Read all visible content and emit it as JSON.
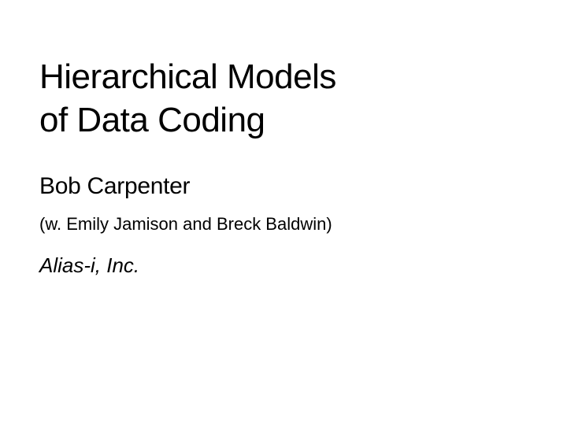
{
  "title_line1": "Hierarchical Models",
  "title_line2": "of Data Coding",
  "author": "Bob Carpenter",
  "coauthors": "(w. Emily Jamison and Breck Baldwin)",
  "affiliation": "Alias-i, Inc."
}
